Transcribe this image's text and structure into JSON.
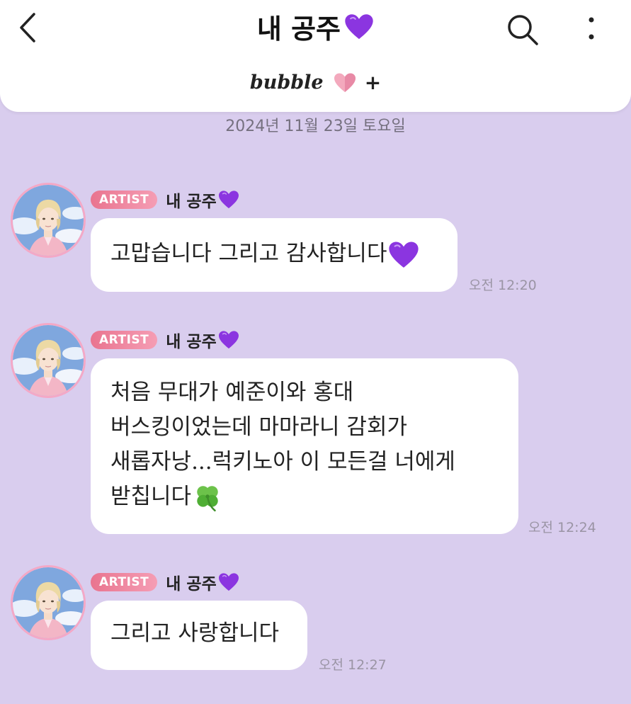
{
  "header": {
    "title": "내 공주",
    "back_icon": "chevron-left-icon",
    "search_icon": "search-icon",
    "more_icon": "more-vertical-icon",
    "brand": "bubble",
    "brand_plus": "+"
  },
  "date_divider": "2024년 11월 23일 토요일",
  "colors": {
    "background": "#d9cdee",
    "badge": "#ec7f9a",
    "heart_purple": "#8b35e0"
  },
  "messages": [
    {
      "badge": "ARTIST",
      "sender": "내 공주",
      "lines": [
        "고맙습니다 그리고 감사합니다"
      ],
      "trailing_emoji": "purple-heart-icon",
      "time": "오전 12:20"
    },
    {
      "badge": "ARTIST",
      "sender": "내 공주",
      "lines": [
        "처음 무대가 예준이와 홍대",
        "버스킹이었는데 마마라니 감회가",
        "새롭자낭...럭키노아 이 모든걸 너에게",
        "받칩니다"
      ],
      "trailing_emoji": "four-leaf-clover-icon",
      "time": "오전 12:24"
    },
    {
      "badge": "ARTIST",
      "sender": "내 공주",
      "lines": [
        "그리고 사랑합니다"
      ],
      "time": "오전 12:27"
    }
  ]
}
